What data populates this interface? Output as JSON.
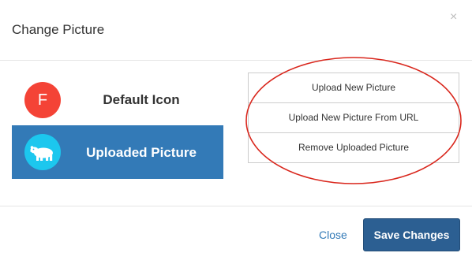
{
  "dialog": {
    "title": "Change Picture",
    "close_icon": "close-icon"
  },
  "picture_options": [
    {
      "label": "Default Icon",
      "avatar_letter": "F",
      "avatar_color": "#f44336",
      "selected": false
    },
    {
      "label": "Uploaded Picture",
      "avatar_icon": "polar-bear-icon",
      "avatar_color": "#1cc7ee",
      "selected": true
    }
  ],
  "actions": [
    {
      "label": "Upload New Picture"
    },
    {
      "label": "Upload New Picture From URL"
    },
    {
      "label": "Remove Uploaded Picture"
    }
  ],
  "footer": {
    "close_label": "Close",
    "save_label": "Save Changes"
  },
  "colors": {
    "selected_bg": "#337ab7",
    "primary_button": "#2c5f92",
    "link": "#337ab7",
    "annotation": "#d9261c"
  }
}
